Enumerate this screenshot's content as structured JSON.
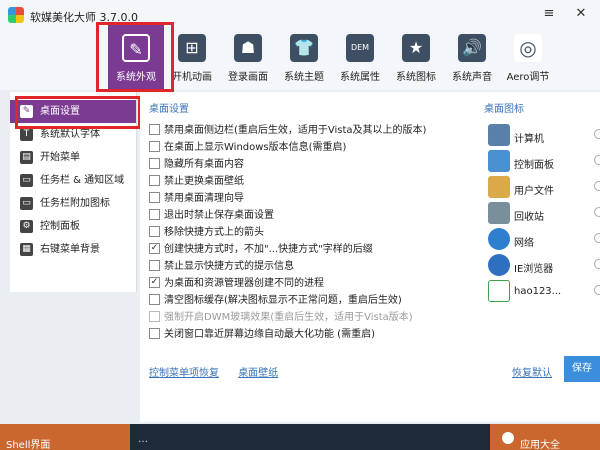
{
  "window": {
    "title": "软媒美化大师 3.7.0.0",
    "menu_icon": "≡",
    "close_icon": "✕"
  },
  "toolbar": {
    "items": [
      {
        "label": "系统外观",
        "icon": "brush-icon"
      },
      {
        "label": "开机动画",
        "icon": "windows-icon"
      },
      {
        "label": "登录画面",
        "icon": "person-icon"
      },
      {
        "label": "系统主题",
        "icon": "shirt-icon"
      },
      {
        "label": "系统属性",
        "icon": "oem-icon"
      },
      {
        "label": "系统图标",
        "icon": "star-icon"
      },
      {
        "label": "系统声音",
        "icon": "speaker-icon"
      },
      {
        "label": "Aero调节",
        "icon": "aero-icon"
      }
    ],
    "icon_glyphs": [
      "✎",
      "⊞",
      "☗",
      "👕",
      "DEM",
      "★",
      "🔊",
      "◎"
    ]
  },
  "sidebar": {
    "items": [
      {
        "label": "桌面设置",
        "icon": "pencil-icon"
      },
      {
        "label": "系统默认字体",
        "icon": "font-icon"
      },
      {
        "label": "开始菜单",
        "icon": "start-menu-icon"
      },
      {
        "label": "任务栏 & 通知区域",
        "icon": "taskbar-icon"
      },
      {
        "label": "任务栏附加图标",
        "icon": "taskbar-extra-icon"
      },
      {
        "label": "控制面板",
        "icon": "control-panel-icon"
      },
      {
        "label": "右键菜单背景",
        "icon": "context-menu-icon"
      }
    ]
  },
  "main": {
    "section_title": "桌面设置",
    "options": [
      {
        "label": "禁用桌面侧边栏(重启后生效，适用于Vista及其以上的版本)",
        "checked": false,
        "disabled": false
      },
      {
        "label": "在桌面上显示Windows版本信息(需重启)",
        "checked": false,
        "disabled": false
      },
      {
        "label": "隐藏所有桌面内容",
        "checked": false,
        "disabled": false
      },
      {
        "label": "禁止更换桌面壁纸",
        "checked": false,
        "disabled": false
      },
      {
        "label": "禁用桌面清理向导",
        "checked": false,
        "disabled": false
      },
      {
        "label": "退出时禁止保存桌面设置",
        "checked": false,
        "disabled": false
      },
      {
        "label": "移除快捷方式上的箭头",
        "checked": false,
        "disabled": false
      },
      {
        "label": "创建快捷方式时，不加\"...快捷方式\"字样的后缀",
        "checked": true,
        "disabled": false
      },
      {
        "label": "禁止显示快捷方式的提示信息",
        "checked": false,
        "disabled": false
      },
      {
        "label": "为桌面和资源管理器创建不同的进程",
        "checked": true,
        "disabled": false
      },
      {
        "label": "清空图标缓存(解决图标显示不正常问题，重启后生效)",
        "checked": false,
        "disabled": false
      },
      {
        "label": "强制开启DWM玻璃效果(重启后生效，适用于Vista版本)",
        "checked": false,
        "disabled": true
      },
      {
        "label": "关闭窗口靠近屏幕边缘自动最大化功能 (需重启)",
        "checked": false,
        "disabled": false
      }
    ],
    "links": {
      "repair_menu": "控制菜单项恢复",
      "wallpaper": "桌面壁纸"
    },
    "checkmark": "✓"
  },
  "desktop_icons": {
    "title": "桌面图标",
    "items": [
      {
        "label": "计算机",
        "color": "#5a7fa8"
      },
      {
        "label": "控制面板",
        "color": "#4a8fcf"
      },
      {
        "label": "用户文件",
        "color": "#d9a94a"
      },
      {
        "label": "回收站",
        "color": "#7a8f9c"
      },
      {
        "label": "网络",
        "color": "#2e7fd0"
      },
      {
        "label": "IE浏览器",
        "color": "#2e6fc0"
      },
      {
        "label": "hao123...",
        "color": "#3aa34a"
      }
    ],
    "restore_label": "恢复默认",
    "save_label": "保存"
  },
  "taskbar": {
    "left_text": "Shell界面",
    "right_text": "应用大全",
    "mid_text": "…"
  },
  "colors": {
    "accent_purple": "#7b3b93",
    "highlight_red": "#e0262b",
    "link_blue": "#3a74b5",
    "save_blue": "#3a8edc",
    "taskbar_orange": "#c9672e"
  }
}
